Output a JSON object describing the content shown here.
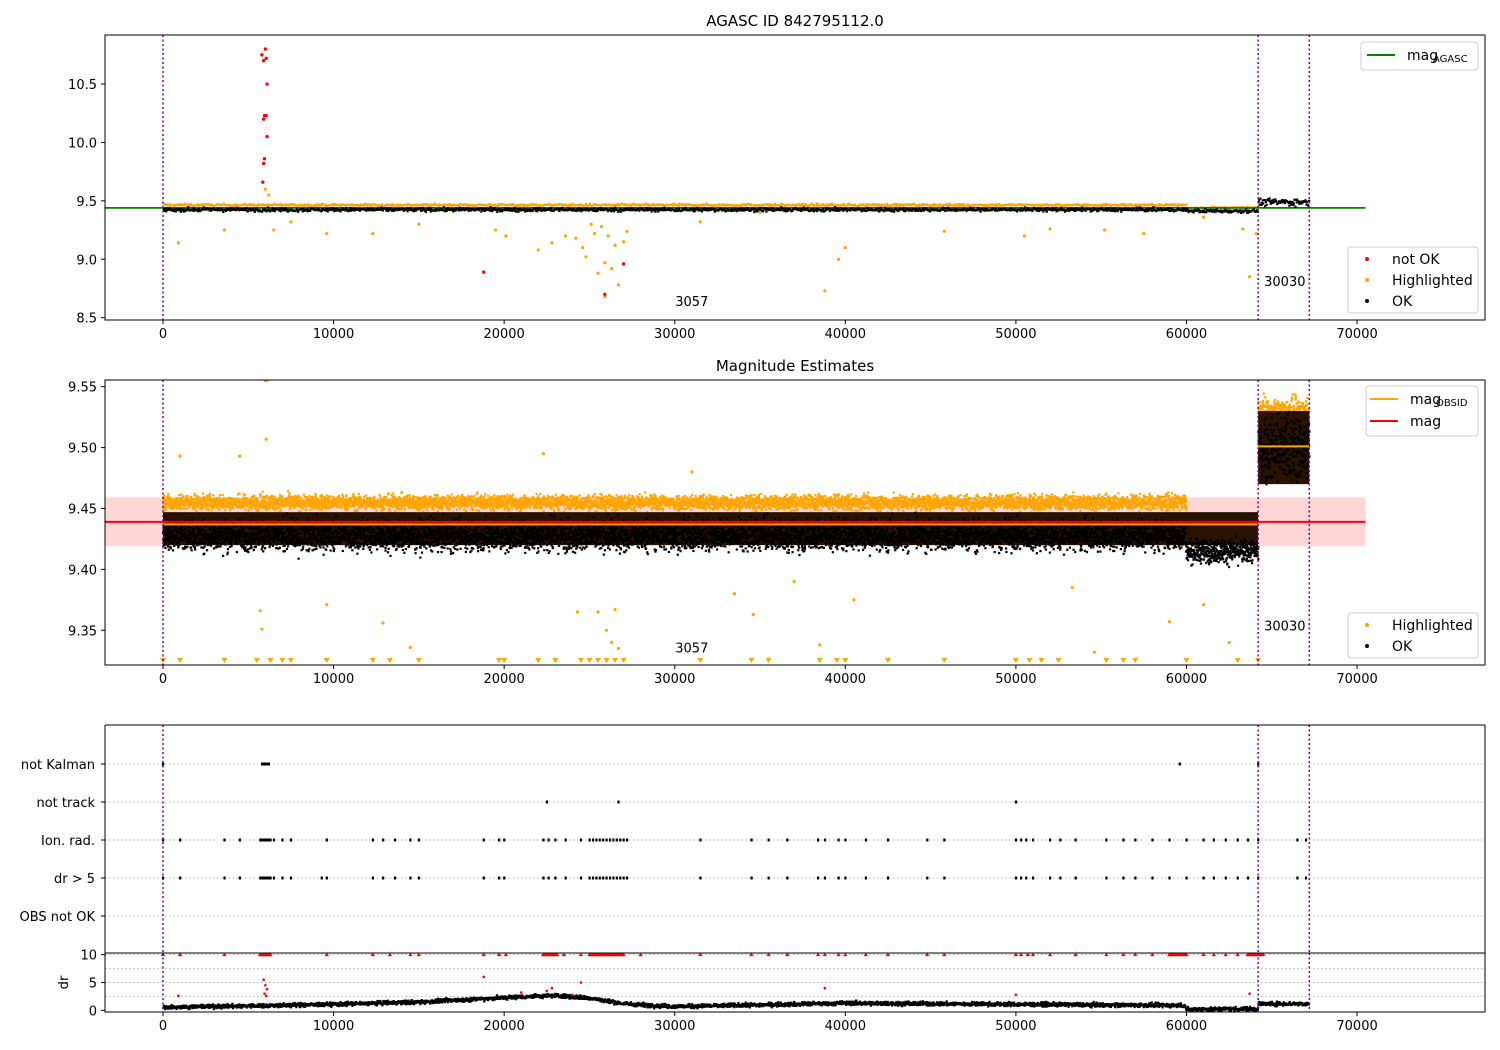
{
  "chart_data": [
    {
      "type": "scatter",
      "title": "AGASC ID 842795112.0",
      "xlim": [
        -3400,
        77500
      ],
      "ylim": [
        8.48,
        10.92
      ],
      "xticks": [
        0,
        10000,
        20000,
        30000,
        40000,
        50000,
        60000,
        70000
      ],
      "yticks": [
        8.5,
        9.0,
        9.5,
        10.0,
        10.5
      ],
      "grid": false,
      "vlines": [
        0,
        64200,
        67200
      ],
      "annotations": [
        {
          "text": "3057",
          "x": 31000,
          "y": 8.55
        },
        {
          "text": "30030",
          "x": 64300,
          "y": 8.72
        }
      ],
      "hlines": [
        {
          "name": "magAGASC",
          "label_main": "mag",
          "label_sub": "AGASC",
          "y": 9.44,
          "color": "#008000",
          "x": [
            -3400,
            70500
          ]
        }
      ],
      "legend_lines": {
        "position": "upper-right"
      },
      "legend_points": {
        "position": "lower-right",
        "entries": [
          {
            "label": "not OK",
            "color": "#ff0000"
          },
          {
            "label": "Highlighted",
            "color": "#ffa500"
          },
          {
            "label": "OK",
            "color": "#000000"
          }
        ]
      },
      "series": [
        {
          "name": "OK",
          "color": "#000000",
          "band": {
            "segments": [
              [
                0,
                60000,
                9.425
              ],
              [
                60000,
                64200,
                9.415
              ],
              [
                64200,
                67200,
                9.49
              ]
            ],
            "halfwidth": [
              0.03,
              0.03,
              0.06
            ]
          }
        },
        {
          "name": "Highlighted",
          "color": "#ffa500",
          "band": {
            "segments": [
              [
                0,
                60000,
                9.465
              ],
              [
                60000,
                64200,
                9.44
              ]
            ],
            "halfwidth": [
              0.02,
              0.02
            ]
          },
          "points": [
            [
              6000,
              9.6
            ],
            [
              6200,
              9.55
            ],
            [
              900,
              9.14
            ],
            [
              3600,
              9.25
            ],
            [
              6500,
              9.25
            ],
            [
              7500,
              9.32
            ],
            [
              9600,
              9.22
            ],
            [
              12300,
              9.22
            ],
            [
              15000,
              9.3
            ],
            [
              19500,
              9.25
            ],
            [
              20100,
              9.2
            ],
            [
              22000,
              9.08
            ],
            [
              22800,
              9.14
            ],
            [
              23600,
              9.2
            ],
            [
              24200,
              9.18
            ],
            [
              24600,
              9.1
            ],
            [
              24800,
              9.02
            ],
            [
              25100,
              9.3
            ],
            [
              25300,
              9.22
            ],
            [
              25500,
              8.88
            ],
            [
              25700,
              9.28
            ],
            [
              25900,
              8.97
            ],
            [
              26100,
              9.2
            ],
            [
              26300,
              8.92
            ],
            [
              26500,
              9.12
            ],
            [
              26700,
              8.78
            ],
            [
              27000,
              9.15
            ],
            [
              27200,
              9.24
            ],
            [
              25900,
              8.68
            ],
            [
              31500,
              9.32
            ],
            [
              35000,
              9.4
            ],
            [
              38800,
              8.73
            ],
            [
              39600,
              9.0
            ],
            [
              40000,
              9.1
            ],
            [
              45800,
              9.24
            ],
            [
              50500,
              9.2
            ],
            [
              52000,
              9.26
            ],
            [
              55200,
              9.25
            ],
            [
              57500,
              9.22
            ],
            [
              61000,
              9.36
            ],
            [
              63300,
              9.26
            ],
            [
              63700,
              8.85
            ],
            [
              64100,
              9.22
            ]
          ]
        },
        {
          "name": "not OK",
          "color": "#ff0000",
          "points": [
            [
              5800,
              10.75
            ],
            [
              5900,
              10.7
            ],
            [
              6000,
              10.8
            ],
            [
              6050,
              10.72
            ],
            [
              6100,
              10.5
            ],
            [
              5950,
              10.23
            ],
            [
              6050,
              10.23
            ],
            [
              5900,
              10.2
            ],
            [
              6100,
              10.05
            ],
            [
              5950,
              9.86
            ],
            [
              5900,
              9.82
            ],
            [
              5850,
              9.66
            ],
            [
              18800,
              8.89
            ],
            [
              25900,
              8.7
            ],
            [
              27000,
              8.96
            ]
          ]
        }
      ]
    },
    {
      "type": "scatter",
      "title": "Magnitude Estimates",
      "xlim": [
        -3400,
        77500
      ],
      "ylim": [
        9.3215,
        9.5555
      ],
      "xticks": [
        0,
        10000,
        20000,
        30000,
        40000,
        50000,
        60000,
        70000
      ],
      "yticks": [
        9.35,
        9.4,
        9.45,
        9.5,
        9.55
      ],
      "grid": false,
      "vlines": [
        0,
        64200,
        67200
      ],
      "annotations": [
        {
          "text": "3057",
          "x": 31000,
          "y": 9.327
        },
        {
          "text": "30030",
          "x": 64300,
          "y": 9.345
        }
      ],
      "mag_band": {
        "y": 9.439,
        "low": 9.419,
        "high": 9.459,
        "x": [
          -3400,
          70500
        ],
        "color": "#ffcccc"
      },
      "hlines": [
        {
          "name": "magOBSID",
          "label_main": "mag",
          "label_sub": "OBSID",
          "color": "#ffa500",
          "segments": [
            [
              0,
              64200,
              9.437
            ],
            [
              64200,
              67200,
              9.501
            ]
          ]
        },
        {
          "name": "mag",
          "label_main": "mag",
          "label_sub": "",
          "color": "#ff0000",
          "segments": [
            [
              -3400,
              70500,
              9.439
            ]
          ]
        }
      ],
      "legend_lines": {
        "position": "upper-right"
      },
      "legend_points": {
        "position": "lower-right",
        "entries": [
          {
            "label": "Highlighted",
            "color": "#ffa500"
          },
          {
            "label": "OK",
            "color": "#000000"
          }
        ]
      },
      "series": [
        {
          "name": "Highlighted",
          "color": "#ffa500",
          "band": {
            "segments": [
              [
                0,
                60000,
                9.455
              ],
              [
                64200,
                67200,
                9.53
              ]
            ],
            "halfwidth": [
              0.012,
              0.02
            ]
          },
          "points": [
            [
              6000,
              9.555
            ],
            [
              6100,
              9.555
            ],
            [
              6050,
              9.507
            ],
            [
              5700,
              9.366
            ],
            [
              5800,
              9.351
            ],
            [
              4500,
              9.493
            ],
            [
              1000,
              9.493
            ],
            [
              9600,
              9.371
            ],
            [
              12900,
              9.356
            ],
            [
              14500,
              9.336
            ],
            [
              22300,
              9.495
            ],
            [
              24300,
              9.365
            ],
            [
              25500,
              9.365
            ],
            [
              26000,
              9.35
            ],
            [
              26500,
              9.367
            ],
            [
              26300,
              9.34
            ],
            [
              26700,
              9.335
            ],
            [
              31000,
              9.48
            ],
            [
              33500,
              9.38
            ],
            [
              34600,
              9.363
            ],
            [
              37000,
              9.39
            ],
            [
              38500,
              9.338
            ],
            [
              40500,
              9.375
            ],
            [
              53300,
              9.385
            ],
            [
              54600,
              9.332
            ],
            [
              59000,
              9.357
            ],
            [
              61000,
              9.371
            ],
            [
              62500,
              9.34
            ],
            [
              6500,
              9.45
            ],
            [
              16000,
              9.455
            ],
            [
              20000,
              9.46
            ],
            [
              30000,
              9.45
            ]
          ]
        },
        {
          "name": "OK",
          "color": "#000000",
          "band": {
            "segments": [
              [
                0,
                60000,
                9.428
              ],
              [
                60000,
                64200,
                9.415
              ],
              [
                64200,
                67200,
                9.5
              ]
            ],
            "halfwidth": [
              0.024,
              0.018,
              0.055
            ]
          }
        }
      ],
      "lower_limit_markers": [
        0,
        1000,
        3600,
        5500,
        6300,
        7000,
        7500,
        9600,
        12300,
        13300,
        15000,
        19700,
        20000,
        22000,
        23000,
        24500,
        25000,
        25500,
        26000,
        26500,
        27000,
        31500,
        34500,
        35500,
        38500,
        39500,
        40000,
        42500,
        45800,
        50000,
        50800,
        51500,
        52500,
        55300,
        56300,
        57000,
        60000,
        63000,
        64200
      ]
    },
    {
      "type": "scatter",
      "title": "",
      "xlim": [
        -3400,
        77500
      ],
      "categories": [
        "not Kalman",
        "not track",
        "Ion. rad.",
        "dr > 5",
        "OBS not OK"
      ],
      "flags": {
        "not Kalman": [
          0,
          5800,
          5900,
          6000,
          6100,
          6200,
          59600,
          64200
        ],
        "not track": [
          22500,
          26700,
          50000
        ],
        "Ion. rad.": [
          0,
          1000,
          3600,
          4500,
          5700,
          5800,
          5900,
          6000,
          6100,
          6200,
          6300,
          6500,
          7000,
          7500,
          9600,
          12300,
          12900,
          13600,
          14500,
          15000,
          18800,
          19700,
          20000,
          22300,
          22600,
          23000,
          23600,
          24500,
          25000,
          25200,
          25400,
          25600,
          25800,
          26000,
          26200,
          26400,
          26600,
          26800,
          27000,
          27200,
          31500,
          34500,
          35500,
          36600,
          38400,
          38800,
          39600,
          40000,
          41200,
          42500,
          44800,
          45800,
          50000,
          50300,
          50600,
          51000,
          52000,
          52600,
          53500,
          55300,
          56300,
          57000,
          58000,
          59000,
          60000,
          61000,
          61600,
          62300,
          63000,
          63600,
          64200,
          66500,
          67000
        ],
        "dr > 5": [
          0,
          1000,
          3600,
          4500,
          5700,
          5800,
          5900,
          6000,
          6100,
          6200,
          6300,
          6500,
          7000,
          7500,
          9300,
          9600,
          12300,
          12900,
          13600,
          14500,
          15000,
          18800,
          19700,
          20000,
          22300,
          22600,
          23000,
          23600,
          24500,
          25000,
          25200,
          25400,
          25600,
          25800,
          26000,
          26200,
          26400,
          26600,
          26800,
          27000,
          27200,
          31500,
          34500,
          35500,
          36600,
          38400,
          38800,
          39600,
          40000,
          41200,
          42500,
          44800,
          45800,
          50000,
          50300,
          50600,
          51000,
          52000,
          52600,
          53500,
          55300,
          56300,
          57000,
          58000,
          59000,
          60000,
          61000,
          61600,
          62300,
          63000,
          63600,
          64200,
          66500,
          67000
        ],
        "OBS not OK": []
      },
      "grid": "horizontal dotted",
      "vlines": [
        0,
        64200,
        67200
      ]
    },
    {
      "type": "scatter",
      "title": "",
      "xlabel": "",
      "ylabel": "dr",
      "xlim": [
        -3400,
        77500
      ],
      "ylim": [
        -0.3,
        10.3
      ],
      "xticks": [
        0,
        10000,
        20000,
        30000,
        40000,
        50000,
        60000,
        70000
      ],
      "yticks": [
        0,
        5,
        10
      ],
      "grid": "horizontal dotted",
      "vlines": [
        0,
        64200,
        67200
      ],
      "series": [
        {
          "name": "dr",
          "color": "#000000",
          "trend": [
            [
              0,
              0.6
            ],
            [
              5000,
              0.8
            ],
            [
              10000,
              1.1
            ],
            [
              15000,
              1.5
            ],
            [
              20000,
              2.3
            ],
            [
              23000,
              2.7
            ],
            [
              25000,
              2.2
            ],
            [
              27000,
              1.2
            ],
            [
              30000,
              0.7
            ],
            [
              35000,
              1.0
            ],
            [
              40000,
              1.3
            ],
            [
              45000,
              1.2
            ],
            [
              50000,
              1.1
            ],
            [
              55000,
              1.0
            ],
            [
              59900,
              0.9
            ],
            [
              60000,
              0.2
            ],
            [
              64200,
              0.3
            ],
            [
              64200,
              1.2
            ],
            [
              67200,
              1.2
            ]
          ]
        },
        {
          "name": "dr > 5",
          "color": "#ff0000",
          "capped_at": 10,
          "capped_x": [
            0,
            1000,
            3600,
            5700,
            5900,
            6100,
            6300,
            9600,
            12300,
            13300,
            14500,
            15000,
            18800,
            19700,
            20100,
            22300,
            22700,
            23000,
            23500,
            24500,
            25200,
            25500,
            25800,
            26100,
            26400,
            26700,
            27000,
            28000,
            31500,
            34500,
            35500,
            36600,
            38400,
            38800,
            39600,
            40000,
            41200,
            42500,
            44800,
            45800,
            50000,
            50300,
            50700,
            51000,
            52000,
            53500,
            55300,
            56300,
            57000,
            58000,
            59000,
            60000,
            61000,
            61600,
            62300,
            63000,
            63600,
            64200,
            64500
          ],
          "points": [
            [
              5900,
              5.5
            ],
            [
              6000,
              4.5
            ],
            [
              6100,
              3.8
            ],
            [
              5950,
              3.0
            ],
            [
              6050,
              2.6
            ],
            [
              18800,
              6.0
            ],
            [
              21000,
              3.2
            ],
            [
              22500,
              3.5
            ],
            [
              22800,
              4.0
            ],
            [
              24500,
              5.0
            ],
            [
              24000,
              2.8
            ],
            [
              38800,
              4.0
            ],
            [
              63700,
              3.0
            ],
            [
              50000,
              2.8
            ],
            [
              900,
              2.6
            ]
          ]
        }
      ]
    }
  ]
}
